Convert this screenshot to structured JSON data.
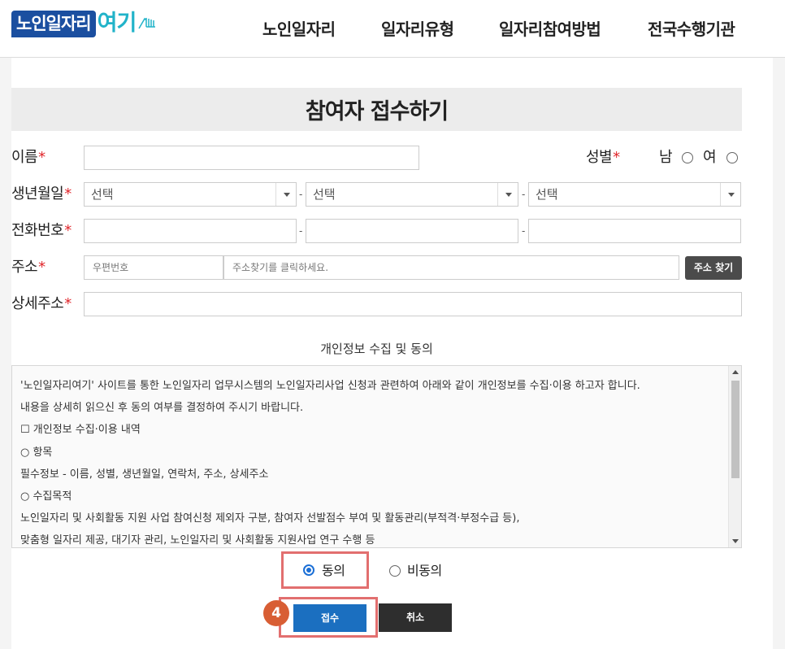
{
  "header": {
    "logo_main": "노인일자리",
    "logo_accent": "여기",
    "nav": [
      "노인일자리",
      "일자리유형",
      "일자리참여방법",
      "전국수행기관"
    ]
  },
  "form": {
    "title": "참여자 접수하기",
    "required_mark": "*",
    "name_label": "이름",
    "gender_label": "성별",
    "gender_male": "남",
    "gender_female": "여",
    "birth_label": "생년월일",
    "birth_select_placeholder": "선택",
    "phone_label": "전화번호",
    "address_label": "주소",
    "postcode_placeholder": "우편번호",
    "address_placeholder": "주소찾기를 클릭하세요.",
    "find_address_button": "주소 찾기",
    "detail_address_label": "상세주소",
    "separator": "-"
  },
  "consent": {
    "heading": "개인정보 수집 및 동의",
    "lines": [
      "'노인일자리여기' 사이트를 통한 노인일자리 업무시스템의 노인일자리사업 신청과 관련하여 아래와 같이 개인정보를 수집·이용 하고자 합니다.",
      "내용을 상세히 읽으신 후 동의 여부를 결정하여 주시기 바랍니다.",
      "☐ 개인정보 수집·이용 내역",
      "○ 항목",
      "필수정보 - 이름, 성별, 생년월일, 연락처, 주소, 상세주소",
      "○ 수집목적",
      "노인일자리 및 사회활동 지원 사업 참여신청 제외자 구분, 참여자 선발점수 부여 및 활동관리(부적격·부정수급 등),",
      "맞춤형 일자리 제공, 대기자 관리, 노인일자리 및 사회활동 지원사업 연구 수행 등"
    ],
    "agree_label": "동의",
    "disagree_label": "비동의",
    "selected": "agree"
  },
  "actions": {
    "submit": "접수",
    "cancel": "취소",
    "step_number": "4"
  },
  "colors": {
    "brand_blue": "#1b4fa0",
    "brand_teal": "#21b3c9",
    "required_red": "#e0262b",
    "submit_blue": "#1b6fc0",
    "highlight": "#e26f6f",
    "step_badge": "#d85e34"
  }
}
